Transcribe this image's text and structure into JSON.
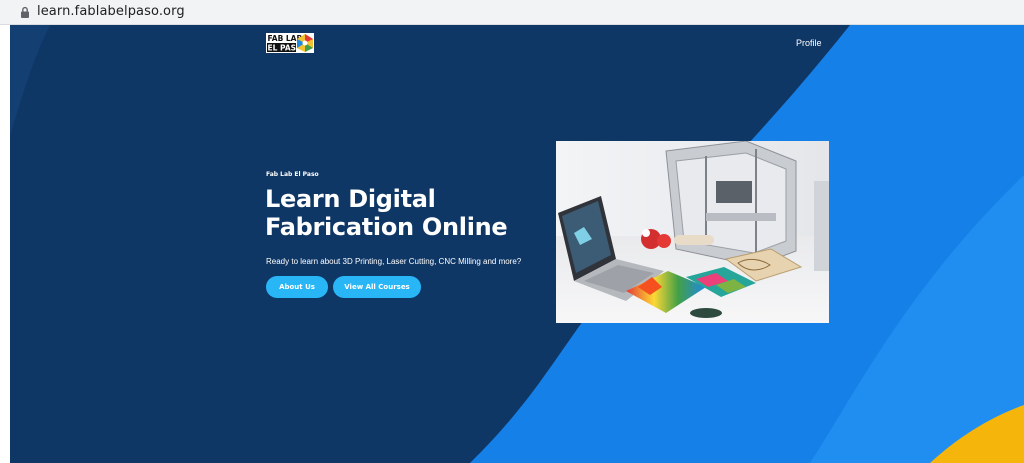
{
  "browser": {
    "url": "learn.fablabelpaso.org"
  },
  "nav": {
    "logo_line1": "FAB LAB",
    "logo_line2": "EL PASO",
    "profile_label": "Profile"
  },
  "hero": {
    "eyebrow": "Fab Lab El Paso",
    "headline_line1": "Learn Digital",
    "headline_line2": "Fabrication Online",
    "tagline": "Ready to learn about 3D Printing, Laser Cutting, CNC Milling and more?",
    "about_button": "About Us",
    "courses_button": "View All Courses"
  },
  "colors": {
    "background_dark": "#0f3766",
    "wave_blue": "#1580e8",
    "wave_light": "#1f8ef0",
    "button": "#29b6f6",
    "accent_yellow": "#f5b50a"
  },
  "icons": {
    "lock": "lock-icon"
  }
}
